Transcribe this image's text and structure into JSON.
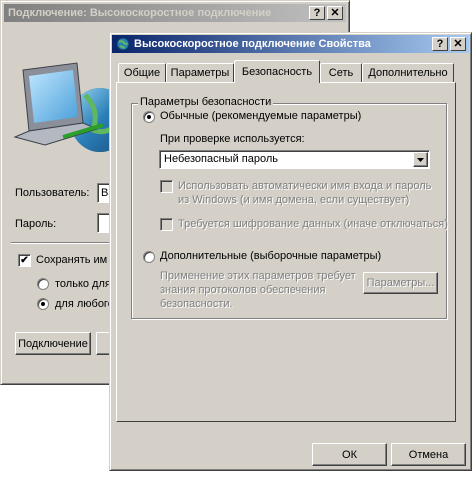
{
  "back_window": {
    "title": "Подключение: Высокоскоростное подключение",
    "user_label": "Пользователь:",
    "user_value": "Ва",
    "password_label": "Пароль:",
    "save_label": "Сохранять им",
    "radio_only_me": "только для",
    "radio_anyone": "для любого",
    "connect_button": "Подключение"
  },
  "front_window": {
    "title": "Высокоскоростное подключение Свойства",
    "tabs": [
      "Общие",
      "Параметры",
      "Безопасность",
      "Сеть",
      "Дополнительно"
    ],
    "active_tab": "Безопасность",
    "group_title": "Параметры безопасности",
    "typical_radio": "Обычные (рекомендуемые параметры)",
    "verify_label": "При проверке используется:",
    "verify_select": "Небезопасный пароль",
    "auto_login_text": "Использовать автоматически имя входа и пароль из Windows (и имя домена, если существует)",
    "encrypt_text": "Требуется шифрование данных (иначе отключаться)",
    "advanced_radio": "Дополнительные (выборочные параметры)",
    "advanced_desc": "Применение этих параметров требует знания протоколов обеспечения безопасности.",
    "params_button": "Параметры...",
    "ok_button": "ОК",
    "cancel_button": "Отмена"
  },
  "titlebar_buttons": {
    "help": "?",
    "close": "✕"
  },
  "colors": {
    "face": "#d4d0c8",
    "active_title": "#0a246a",
    "inactive_title": "#808080"
  }
}
